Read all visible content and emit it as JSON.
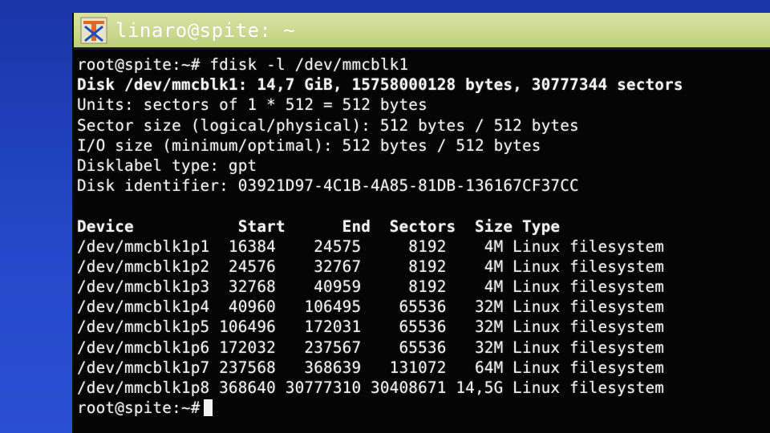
{
  "window": {
    "title": "linaro@spite: ~"
  },
  "terminal": {
    "command_line": "root@spite:~# fdisk -l /dev/mmcblk1",
    "disk_line": "Disk /dev/mmcblk1: 14,7 GiB, 15758000128 bytes, 30777344 sectors",
    "info_lines": [
      "Units: sectors of 1 * 512 = 512 bytes",
      "Sector size (logical/physical): 512 bytes / 512 bytes",
      "I/O size (minimum/optimal): 512 bytes / 512 bytes",
      "Disklabel type: gpt",
      "Disk identifier: 03921D97-4C1B-4A85-81DB-136167CF37CC"
    ],
    "table_header": "Device           Start      End  Sectors  Size Type",
    "rows": [
      "/dev/mmcblk1p1  16384    24575     8192    4M Linux filesystem",
      "/dev/mmcblk1p2  24576    32767     8192    4M Linux filesystem",
      "/dev/mmcblk1p3  32768    40959     8192    4M Linux filesystem",
      "/dev/mmcblk1p4  40960   106495    65536   32M Linux filesystem",
      "/dev/mmcblk1p5 106496   172031    65536   32M Linux filesystem",
      "/dev/mmcblk1p6 172032   237567    65536   32M Linux filesystem",
      "/dev/mmcblk1p7 237568   368639   131072   64M Linux filesystem",
      "/dev/mmcblk1p8 368640 30777310 30408671 14,5G Linux filesystem"
    ],
    "final_prompt": "root@spite:~#"
  }
}
